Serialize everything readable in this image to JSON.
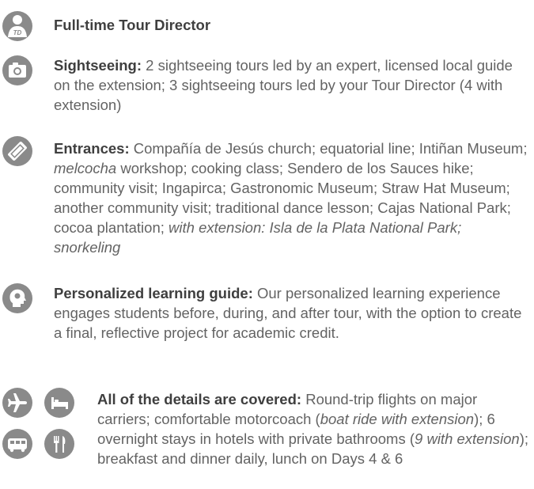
{
  "tour_director": {
    "icon_label": "TD",
    "label": "Full-time Tour Director"
  },
  "sightseeing": {
    "label": "Sightseeing:",
    "text": " 2 sightseeing tours led by an expert, licensed local guide on the extension; 3 sightseeing tours led by your Tour Director (4 with extension)"
  },
  "entrances": {
    "label": "Entrances:",
    "text_1": " Compañía de Jesús church; equatorial line; Intiñan Museum; ",
    "italic_1": "melcocha",
    "text_2": " workshop; cooking class; Sendero de los Sauces hike; community visit; Ingapirca; Gastronomic Museum; Straw Hat Museum; another community visit; traditional dance lesson; Cajas National Park; cocoa plantation; ",
    "italic_2": "with extension: Isla de la Plata National Park; snorkeling"
  },
  "learning_guide": {
    "label": "Personalized learning guide:",
    "text": " Our personalized learning experience engages students before, during, and after tour, with the option to create a final, reflective project for academic credit."
  },
  "details": {
    "label": "All of the details are covered:",
    "text_1": " Round-trip flights on major carriers; comfortable motorcoach (",
    "italic_1": "boat ride with extension",
    "text_2": "); 6 overnight stays in hotels with private bathrooms (",
    "italic_2": "9 with extension",
    "text_3": "); breakfast and dinner daily, lunch on Days 4 & 6"
  },
  "colors": {
    "icon_bg": "#8a8a8a",
    "label_text": "#3f3f3f",
    "body_text": "#636363"
  }
}
